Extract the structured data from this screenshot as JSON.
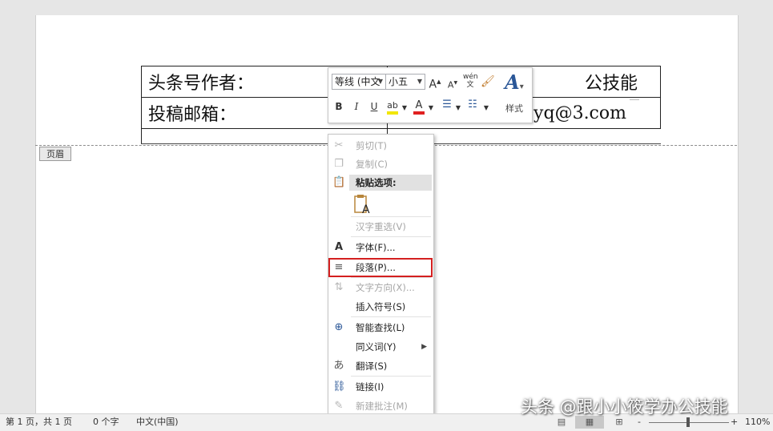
{
  "document": {
    "header_label": "页眉",
    "table": [
      [
        "头条号作者：",
        "公技能"
      ],
      [
        "投稿邮箱：",
        "2yq@3.com"
      ]
    ]
  },
  "mini_toolbar": {
    "font_name": "等线 (中文",
    "font_size": "小五",
    "grow_font": "A",
    "shrink_font": "A",
    "phonetic": "wén",
    "bold": "B",
    "italic": "I",
    "underline": "U",
    "styles_label": "样式",
    "highlight_color": "#f2e600",
    "font_color": "#e02020"
  },
  "context_menu": {
    "items": [
      {
        "label": "剪切(T)",
        "icon": "scissors-icon",
        "enabled": false
      },
      {
        "label": "复制(C)",
        "icon": "copy-icon",
        "enabled": false
      },
      {
        "label": "粘贴选项:",
        "icon": "paste-icon",
        "enabled": true
      },
      {
        "label": "汉字重选(V)",
        "icon": "",
        "enabled": false
      },
      {
        "label": "字体(F)...",
        "icon": "font-icon",
        "enabled": true
      },
      {
        "label": "段落(P)...",
        "icon": "paragraph-icon",
        "enabled": true
      },
      {
        "label": "文字方向(X)...",
        "icon": "text-direction-icon",
        "enabled": false
      },
      {
        "label": "插入符号(S)",
        "icon": "",
        "enabled": true
      },
      {
        "label": "智能查找(L)",
        "icon": "smart-lookup-icon",
        "enabled": true
      },
      {
        "label": "同义词(Y)",
        "icon": "",
        "enabled": true
      },
      {
        "label": "翻译(S)",
        "icon": "translate-icon",
        "enabled": true
      },
      {
        "label": "链接(I)",
        "icon": "link-icon",
        "enabled": true
      },
      {
        "label": "新建批注(M)",
        "icon": "comment-icon",
        "enabled": false
      }
    ],
    "highlighted": "段落(P)..."
  },
  "status_bar": {
    "page_info": "第 1 页，共 1 页",
    "word_count": "0 个字",
    "language": "中文(中国)",
    "zoom_minus": "-",
    "zoom_plus": "+",
    "zoom": "110%"
  },
  "watermark": "头条 @跟小小筱学办公技能"
}
